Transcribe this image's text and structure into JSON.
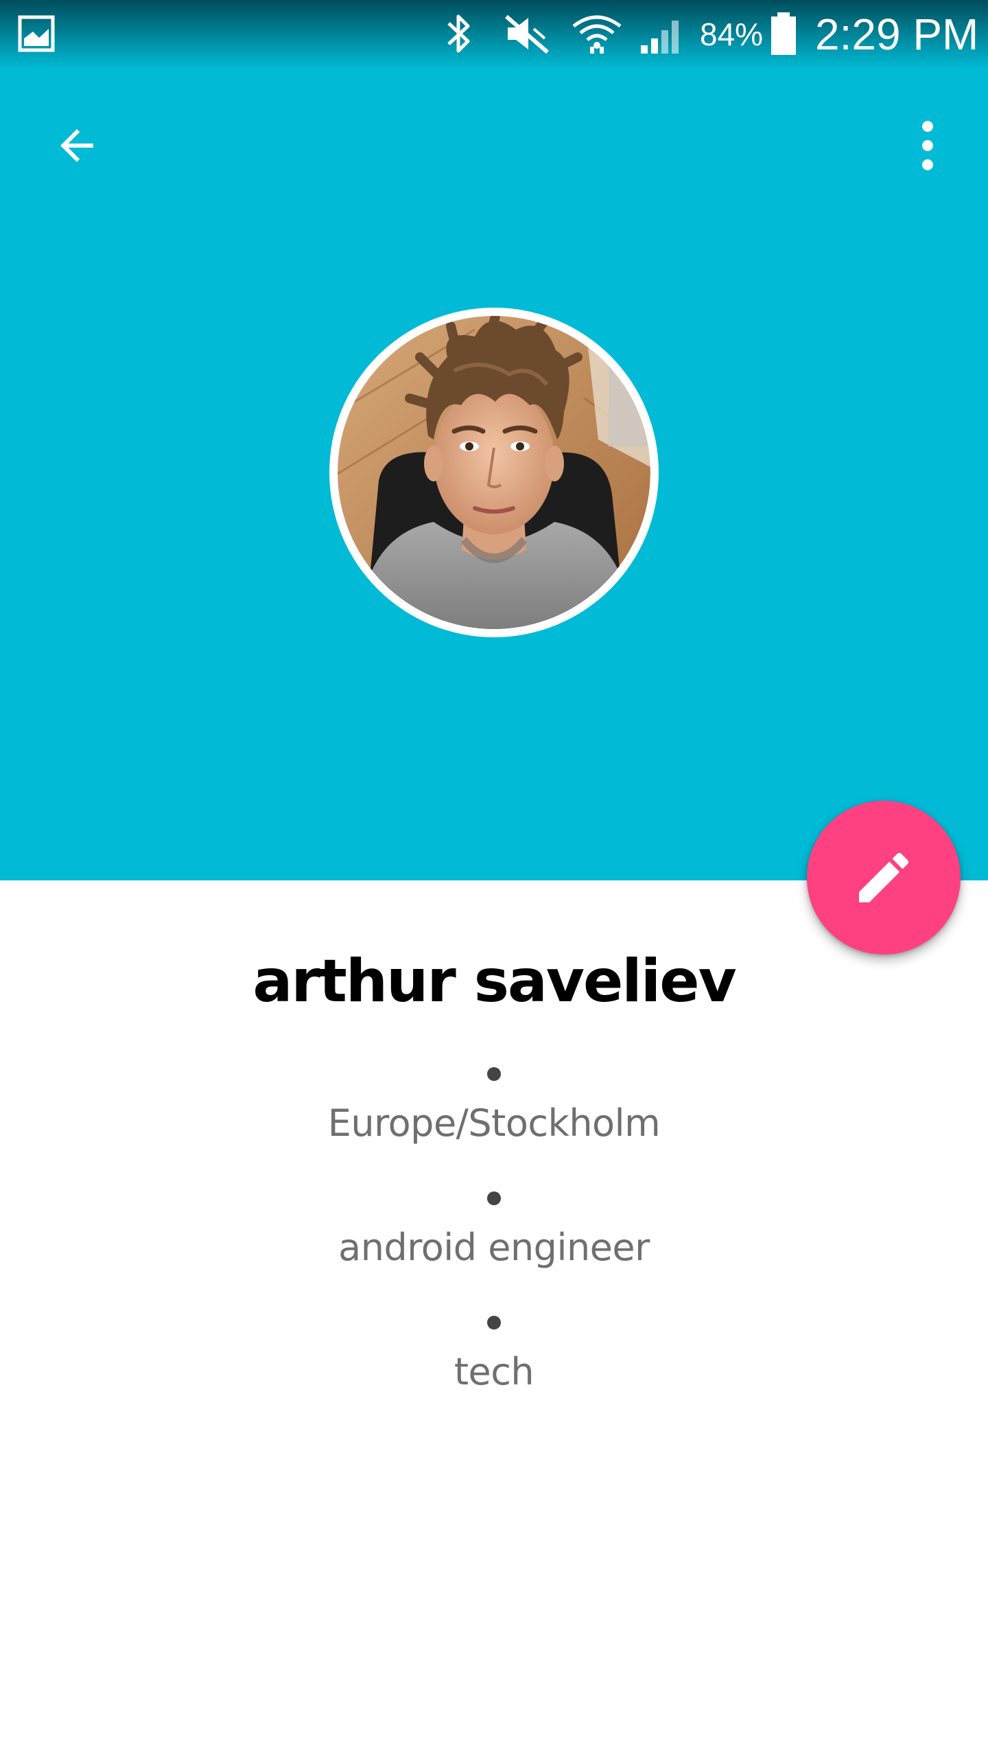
{
  "status_bar": {
    "notification_icon": "gallery-icon",
    "icons": [
      "bluetooth-icon",
      "vibrate-mute-icon",
      "wifi-icon",
      "cell-signal-icon",
      "battery-icon"
    ],
    "battery_percent": "84%",
    "time": "2:29 PM"
  },
  "toolbar": {
    "back_icon": "arrow-back-icon",
    "overflow_icon": "more-vert-icon"
  },
  "profile": {
    "avatar": "profile-photo",
    "name": "arthur saveliev",
    "details": [
      "Europe/Stockholm",
      "android engineer",
      "tech"
    ]
  },
  "fab": {
    "icon": "edit-pencil-icon"
  },
  "colors": {
    "header": "#00bad6",
    "status_bar": "#00899e",
    "fab": "#ff4081",
    "name_text": "#000000",
    "detail_text": "#6f6f6f"
  }
}
